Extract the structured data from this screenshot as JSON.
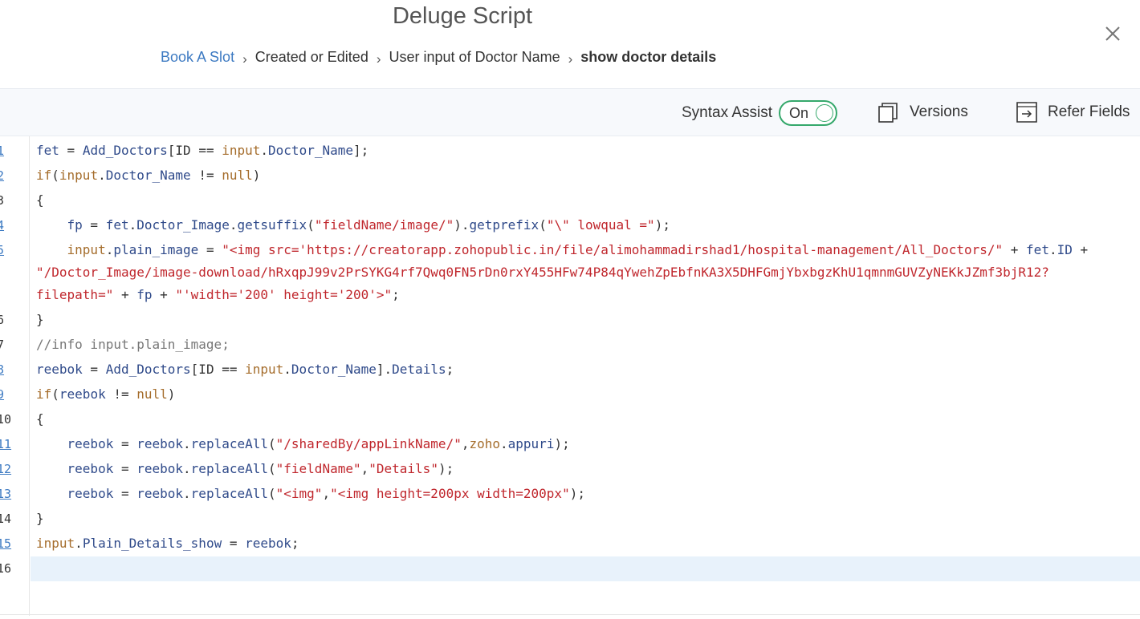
{
  "header": {
    "title": "Deluge Script",
    "breadcrumb": [
      "Book A Slot",
      "Created or Edited",
      "User input of Doctor Name",
      "show doctor details"
    ],
    "separator": "›"
  },
  "toolbar": {
    "syntax_assist_label": "Syntax Assist",
    "toggle_state": "On",
    "versions_label": "Versions",
    "refer_fields_label": "Refer Fields"
  },
  "editor": {
    "line_numbers": [
      "1",
      "2",
      "3",
      "4",
      "5",
      "6",
      "7",
      "8",
      "9",
      "10",
      "11",
      "12",
      "13",
      "14",
      "15",
      "16"
    ],
    "lines": [
      [
        [
          "v",
          "fet"
        ],
        [
          "p",
          " = "
        ],
        [
          "v",
          "Add_Doctors"
        ],
        [
          "p",
          "[ID == "
        ],
        [
          "k",
          "input"
        ],
        [
          "p",
          "."
        ],
        [
          "v",
          "Doctor_Name"
        ],
        [
          "p",
          "];"
        ]
      ],
      [
        [
          "k",
          "if"
        ],
        [
          "p",
          "("
        ],
        [
          "k",
          "input"
        ],
        [
          "p",
          "."
        ],
        [
          "v",
          "Doctor_Name"
        ],
        [
          "p",
          " != "
        ],
        [
          "k",
          "null"
        ],
        [
          "p",
          ")"
        ]
      ],
      [
        [
          "p",
          "{"
        ]
      ],
      [
        [
          "p",
          "    "
        ],
        [
          "v",
          "fp"
        ],
        [
          "p",
          " = "
        ],
        [
          "v",
          "fet"
        ],
        [
          "p",
          "."
        ],
        [
          "v",
          "Doctor_Image"
        ],
        [
          "p",
          "."
        ],
        [
          "v",
          "getsuffix"
        ],
        [
          "p",
          "("
        ],
        [
          "s",
          "\"fieldName/image/\""
        ],
        [
          "p",
          ")."
        ],
        [
          "v",
          "getprefix"
        ],
        [
          "p",
          "("
        ],
        [
          "s",
          "\"\\\" lowqual =\""
        ],
        [
          "p",
          ");"
        ]
      ],
      [
        [
          "p",
          "    "
        ],
        [
          "k",
          "input"
        ],
        [
          "p",
          "."
        ],
        [
          "v",
          "plain_image"
        ],
        [
          "p",
          " = "
        ],
        [
          "s",
          "\"<img src='https://creatorapp.zohopublic.in/file/alimohammadirshad1/hospital-management/All_Doctors/\""
        ],
        [
          "p",
          " + "
        ],
        [
          "v",
          "fet"
        ],
        [
          "p",
          "."
        ],
        [
          "v",
          "ID"
        ],
        [
          "p",
          " +"
        ]
      ],
      [
        [
          "s",
          "\"/Doctor_Image/image-download/hRxqpJ99v2PrSYKG4rf7Qwq0FN5rDn0rxY455HFw74P84qYwehZpEbfnKA3X5DHFGmjYbxbgzKhU1qmnmGUVZyNEKkJZmf3bjR12?"
        ]
      ],
      [
        [
          "s",
          "filepath=\""
        ],
        [
          "p",
          " + "
        ],
        [
          "v",
          "fp"
        ],
        [
          "p",
          " + "
        ],
        [
          "s",
          "\"'width='200' height='200'>\""
        ],
        [
          "p",
          ";"
        ]
      ],
      [
        [
          "p",
          "}"
        ]
      ],
      [
        [
          "c",
          "//info input.plain_image;"
        ]
      ],
      [
        [
          "v",
          "reebok"
        ],
        [
          "p",
          " = "
        ],
        [
          "v",
          "Add_Doctors"
        ],
        [
          "p",
          "[ID == "
        ],
        [
          "k",
          "input"
        ],
        [
          "p",
          "."
        ],
        [
          "v",
          "Doctor_Name"
        ],
        [
          "p",
          "]."
        ],
        [
          "v",
          "Details"
        ],
        [
          "p",
          ";"
        ]
      ],
      [
        [
          "k",
          "if"
        ],
        [
          "p",
          "("
        ],
        [
          "v",
          "reebok"
        ],
        [
          "p",
          " != "
        ],
        [
          "k",
          "null"
        ],
        [
          "p",
          ")"
        ]
      ],
      [
        [
          "p",
          "{"
        ]
      ],
      [
        [
          "p",
          "    "
        ],
        [
          "v",
          "reebok"
        ],
        [
          "p",
          " = "
        ],
        [
          "v",
          "reebok"
        ],
        [
          "p",
          "."
        ],
        [
          "v",
          "replaceAll"
        ],
        [
          "p",
          "("
        ],
        [
          "s",
          "\"/sharedBy/appLinkName/\""
        ],
        [
          "p",
          ","
        ],
        [
          "k",
          "zoho"
        ],
        [
          "p",
          "."
        ],
        [
          "v",
          "appuri"
        ],
        [
          "p",
          ");"
        ]
      ],
      [
        [
          "p",
          "    "
        ],
        [
          "v",
          "reebok"
        ],
        [
          "p",
          " = "
        ],
        [
          "v",
          "reebok"
        ],
        [
          "p",
          "."
        ],
        [
          "v",
          "replaceAll"
        ],
        [
          "p",
          "("
        ],
        [
          "s",
          "\"fieldName\""
        ],
        [
          "p",
          ","
        ],
        [
          "s",
          "\"Details\""
        ],
        [
          "p",
          ");"
        ]
      ],
      [
        [
          "p",
          "    "
        ],
        [
          "v",
          "reebok"
        ],
        [
          "p",
          " = "
        ],
        [
          "v",
          "reebok"
        ],
        [
          "p",
          "."
        ],
        [
          "v",
          "replaceAll"
        ],
        [
          "p",
          "("
        ],
        [
          "s",
          "\"<img\""
        ],
        [
          "p",
          ","
        ],
        [
          "s",
          "\"<img height=200px width=200px\""
        ],
        [
          "p",
          ");"
        ]
      ],
      [
        [
          "p",
          "}"
        ]
      ],
      [
        [
          "k",
          "input"
        ],
        [
          "p",
          "."
        ],
        [
          "v",
          "Plain_Details_show"
        ],
        [
          "p",
          " = "
        ],
        [
          "v",
          "reebok"
        ],
        [
          "p",
          ";"
        ]
      ],
      [
        [
          "p",
          ""
        ]
      ]
    ]
  },
  "colors": {
    "link": "#3d7ac2",
    "toggle_on": "#35a86b",
    "string": "#c0272d",
    "keyword": "#a56d2c",
    "identifier": "#2f4a8a",
    "active_line": "#e8f2fb"
  }
}
